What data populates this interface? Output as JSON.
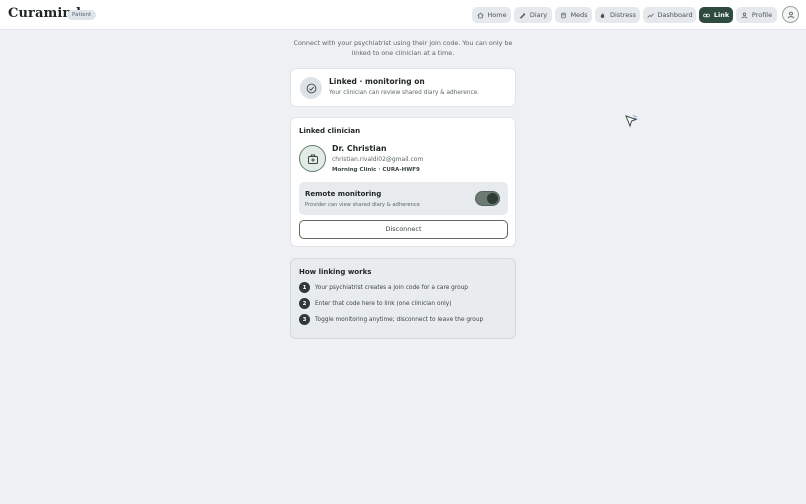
{
  "brand": {
    "name": "Curamind",
    "role": "Patient"
  },
  "nav": [
    {
      "label": "Home",
      "icon": "home-icon",
      "active": false
    },
    {
      "label": "Diary",
      "icon": "diary-icon",
      "active": false
    },
    {
      "label": "Meds",
      "icon": "meds-icon",
      "active": false
    },
    {
      "label": "Distress",
      "icon": "distress-icon",
      "active": false
    },
    {
      "label": "Dashboard",
      "icon": "dashboard-icon",
      "active": false
    },
    {
      "label": "Link",
      "icon": "link-icon",
      "active": true
    },
    {
      "label": "Profile",
      "icon": "profile-icon",
      "active": false
    }
  ],
  "intro": "Connect with your psychiatrist using their join code. You can only be linked to one clinician at a time.",
  "status": {
    "title": "Linked · monitoring on",
    "subtitle": "Your clinician can review shared diary & adherence."
  },
  "linked": {
    "section_title": "Linked clinician",
    "name": "Dr. Christian",
    "email": "christian.rivaldi02@gmail.com",
    "clinic": "Morning Clinic · CURA-HWF9",
    "monitoring": {
      "title": "Remote monitoring",
      "subtitle": "Provider can view shared diary & adherence",
      "enabled": true
    },
    "disconnect_label": "Disconnect"
  },
  "how": {
    "title": "How linking works",
    "steps": [
      {
        "num": "1",
        "text": "Your psychiatrist creates a join code for a care group"
      },
      {
        "num": "2",
        "text": "Enter that code here to link (one clinician only)"
      },
      {
        "num": "3",
        "text": "Toggle monitoring anytime; disconnect to leave the group"
      }
    ]
  },
  "colors": {
    "accent": "#2f4a3f",
    "background": "#eef0f3",
    "toggle_on": "#6b7a72"
  }
}
